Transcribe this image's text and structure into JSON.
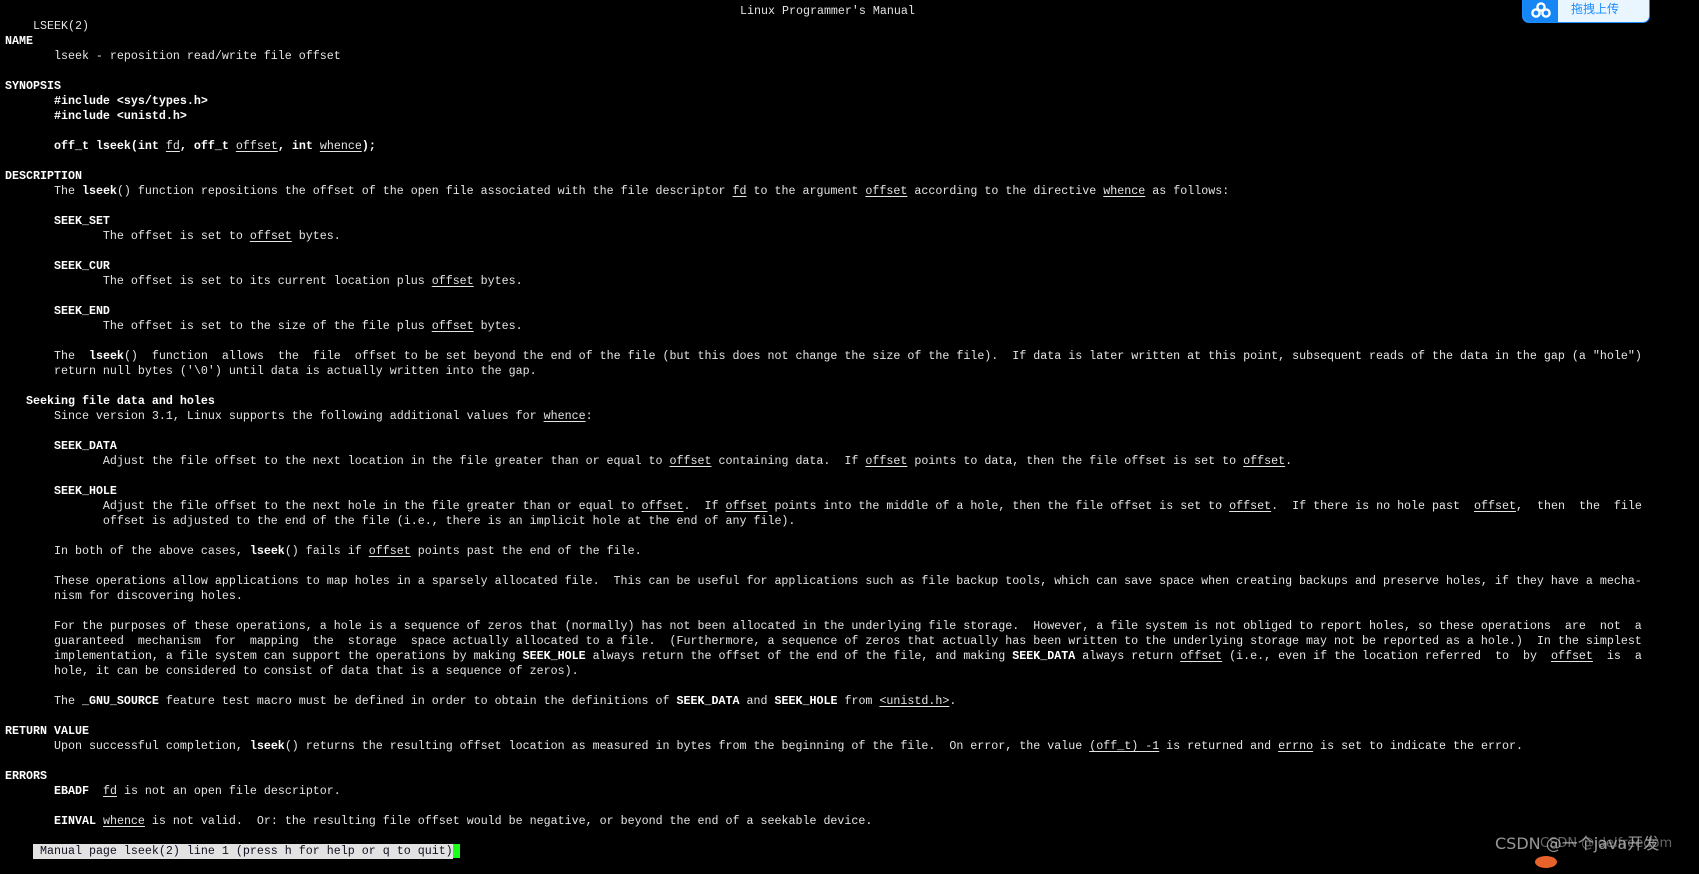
{
  "header": {
    "left": "LSEEK(2)",
    "center": "Linux Programmer's Manual"
  },
  "upload_badge": {
    "label": "拖拽上传",
    "icon": "baidu-cloud-icon",
    "color": "#1786f5"
  },
  "lines": [
    [],
    [],
    [
      [
        "NAME",
        "b"
      ]
    ],
    [
      [
        "       lseek - reposition read/write file offset"
      ]
    ],
    [],
    [
      [
        "SYNOPSIS",
        "b"
      ]
    ],
    [
      [
        "       "
      ],
      [
        "#include <sys/types.h>",
        "b"
      ]
    ],
    [
      [
        "       "
      ],
      [
        "#include <unistd.h>",
        "b"
      ]
    ],
    [],
    [
      [
        "       "
      ],
      [
        "off_t lseek(int ",
        "b"
      ],
      [
        "fd",
        "u"
      ],
      [
        ", ",
        "b"
      ],
      [
        "off_t ",
        "b"
      ],
      [
        "offset",
        "u"
      ],
      [
        ", int ",
        "b"
      ],
      [
        "whence",
        "u"
      ],
      [
        ");",
        "b"
      ]
    ],
    [],
    [
      [
        "DESCRIPTION",
        "b"
      ]
    ],
    [
      [
        "       The "
      ],
      [
        "lseek",
        "b"
      ],
      [
        "() function repositions the offset of the open file associated with the file descriptor "
      ],
      [
        "fd",
        "u"
      ],
      [
        " to the argument "
      ],
      [
        "offset",
        "u"
      ],
      [
        " according to the directive "
      ],
      [
        "whence",
        "u"
      ],
      [
        " as follows:"
      ]
    ],
    [],
    [
      [
        "       "
      ],
      [
        "SEEK_SET",
        "b"
      ]
    ],
    [
      [
        "              The offset is set to "
      ],
      [
        "offset",
        "u"
      ],
      [
        " bytes."
      ]
    ],
    [],
    [
      [
        "       "
      ],
      [
        "SEEK_CUR",
        "b"
      ]
    ],
    [
      [
        "              The offset is set to its current location plus "
      ],
      [
        "offset",
        "u"
      ],
      [
        " bytes."
      ]
    ],
    [],
    [
      [
        "       "
      ],
      [
        "SEEK_END",
        "b"
      ]
    ],
    [
      [
        "              The offset is set to the size of the file plus "
      ],
      [
        "offset",
        "u"
      ],
      [
        " bytes."
      ]
    ],
    [],
    [
      [
        "       The  "
      ],
      [
        "lseek",
        "b"
      ],
      [
        "()  function  allows  the  file  offset to be set beyond the end of the file (but this does not change the size of the file).  If data is later written at this point, subsequent reads of the data in the gap (a \"hole\")"
      ]
    ],
    [
      [
        "       return null bytes ('\\0') until data is actually written into the gap."
      ]
    ],
    [],
    [
      [
        "   "
      ],
      [
        "Seeking file data and holes",
        "b"
      ]
    ],
    [
      [
        "       Since version 3.1, Linux supports the following additional values for "
      ],
      [
        "whence",
        "u"
      ],
      [
        ":"
      ]
    ],
    [],
    [
      [
        "       "
      ],
      [
        "SEEK_DATA",
        "b"
      ]
    ],
    [
      [
        "              Adjust the file offset to the next location in the file greater than or equal to "
      ],
      [
        "offset",
        "u"
      ],
      [
        " containing data.  If "
      ],
      [
        "offset",
        "u"
      ],
      [
        " points to data, then the file offset is set to "
      ],
      [
        "offset",
        "u"
      ],
      [
        "."
      ]
    ],
    [],
    [
      [
        "       "
      ],
      [
        "SEEK_HOLE",
        "b"
      ]
    ],
    [
      [
        "              Adjust the file offset to the next hole in the file greater than or equal to "
      ],
      [
        "offset",
        "u"
      ],
      [
        ".  If "
      ],
      [
        "offset",
        "u"
      ],
      [
        " points into the middle of a hole, then the file offset is set to "
      ],
      [
        "offset",
        "u"
      ],
      [
        ".  If there is no hole past  "
      ],
      [
        "offset",
        "u"
      ],
      [
        ",  then  the  file"
      ]
    ],
    [
      [
        "              offset is adjusted to the end of the file (i.e., there is an implicit hole at the end of any file)."
      ]
    ],
    [],
    [
      [
        "       In both of the above cases, "
      ],
      [
        "lseek",
        "b"
      ],
      [
        "() fails if "
      ],
      [
        "offset",
        "u"
      ],
      [
        " points past the end of the file."
      ]
    ],
    [],
    [
      [
        "       These operations allow applications to map holes in a sparsely allocated file.  This can be useful for applications such as file backup tools, which can save space when creating backups and preserve holes, if they have a mecha-"
      ]
    ],
    [
      [
        "       nism for discovering holes."
      ]
    ],
    [],
    [
      [
        "       For the purposes of these operations, a hole is a sequence of zeros that (normally) has not been allocated in the underlying file storage.  However, a file system is not obliged to report holes, so these operations  are  not  a"
      ]
    ],
    [
      [
        "       guaranteed  mechanism  for  mapping  the  storage  space actually allocated to a file.  (Furthermore, a sequence of zeros that actually has been written to the underlying storage may not be reported as a hole.)  In the simplest"
      ]
    ],
    [
      [
        "       implementation, a file system can support the operations by making "
      ],
      [
        "SEEK_HOLE",
        "b"
      ],
      [
        " always return the offset of the end of the file, and making "
      ],
      [
        "SEEK_DATA",
        "b"
      ],
      [
        " always return "
      ],
      [
        "offset",
        "u"
      ],
      [
        " (i.e., even if the location referred  to  by  "
      ],
      [
        "offset",
        "u"
      ],
      [
        "  is  a"
      ]
    ],
    [
      [
        "       hole, it can be considered to consist of data that is a sequence of zeros)."
      ]
    ],
    [],
    [
      [
        "       The "
      ],
      [
        "_GNU_SOURCE",
        "b"
      ],
      [
        " feature test macro must be defined in order to obtain the definitions of "
      ],
      [
        "SEEK_DATA",
        "b"
      ],
      [
        " and "
      ],
      [
        "SEEK_HOLE",
        "b"
      ],
      [
        " from "
      ],
      [
        "<unistd.h>",
        "u"
      ],
      [
        "."
      ]
    ],
    [],
    [
      [
        "RETURN VALUE",
        "b"
      ]
    ],
    [
      [
        "       Upon successful completion, "
      ],
      [
        "lseek",
        "b"
      ],
      [
        "() returns the resulting offset location as measured in bytes from the beginning of the file.  On error, the value "
      ],
      [
        "(off_t) -1",
        "u"
      ],
      [
        " is returned and "
      ],
      [
        "errno",
        "u"
      ],
      [
        " is set to indicate the error."
      ]
    ],
    [],
    [
      [
        "ERRORS",
        "b"
      ]
    ],
    [
      [
        "       "
      ],
      [
        "EBADF",
        "b"
      ],
      [
        "  "
      ],
      [
        "fd",
        "u"
      ],
      [
        " is not an open file descriptor."
      ]
    ],
    [],
    [
      [
        "       "
      ],
      [
        "EINVAL",
        "b"
      ],
      [
        " "
      ],
      [
        "whence",
        "u"
      ],
      [
        " is not valid.  Or: the resulting file offset would be negative, or beyond the end of a seekable device."
      ]
    ]
  ],
  "status_bar": {
    "text": " Manual page lseek(2) line 1 (press h for help or q to quit)",
    "cursor_color": "#1aff1a"
  },
  "watermark": {
    "text": "CSDN @一个java开发",
    "overlap_text": "CSDN @idelfreedom"
  }
}
